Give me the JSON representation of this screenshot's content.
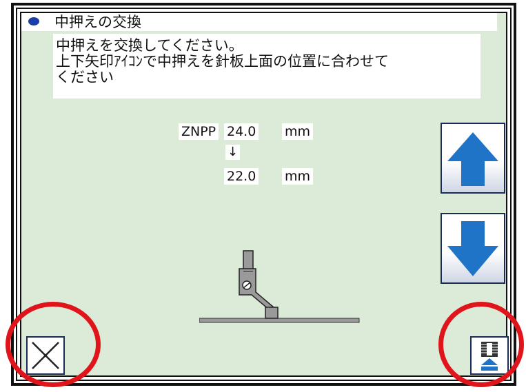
{
  "dialog": {
    "title": "中押えの交換",
    "message_lines": [
      "中押えを交換してください。",
      "上下矢印ｱｲｺﾝで中押えを針板上面の位置に合わせて",
      "ください"
    ]
  },
  "height": {
    "label": "ZNPP",
    "from_value": "24.0",
    "from_unit": "mm",
    "arrow": "↓",
    "to_value": "22.0",
    "unit": "mm"
  },
  "icons": {
    "up": "arrow-up-icon",
    "down": "arrow-down-icon",
    "cancel": "close-icon",
    "home": "presser-foot-raise-icon",
    "diagram": "presser-foot-icon"
  },
  "colors": {
    "panel_bg": "#dcebd8",
    "accent_blue": "#1f74c7",
    "highlight_red": "#e0151b"
  }
}
